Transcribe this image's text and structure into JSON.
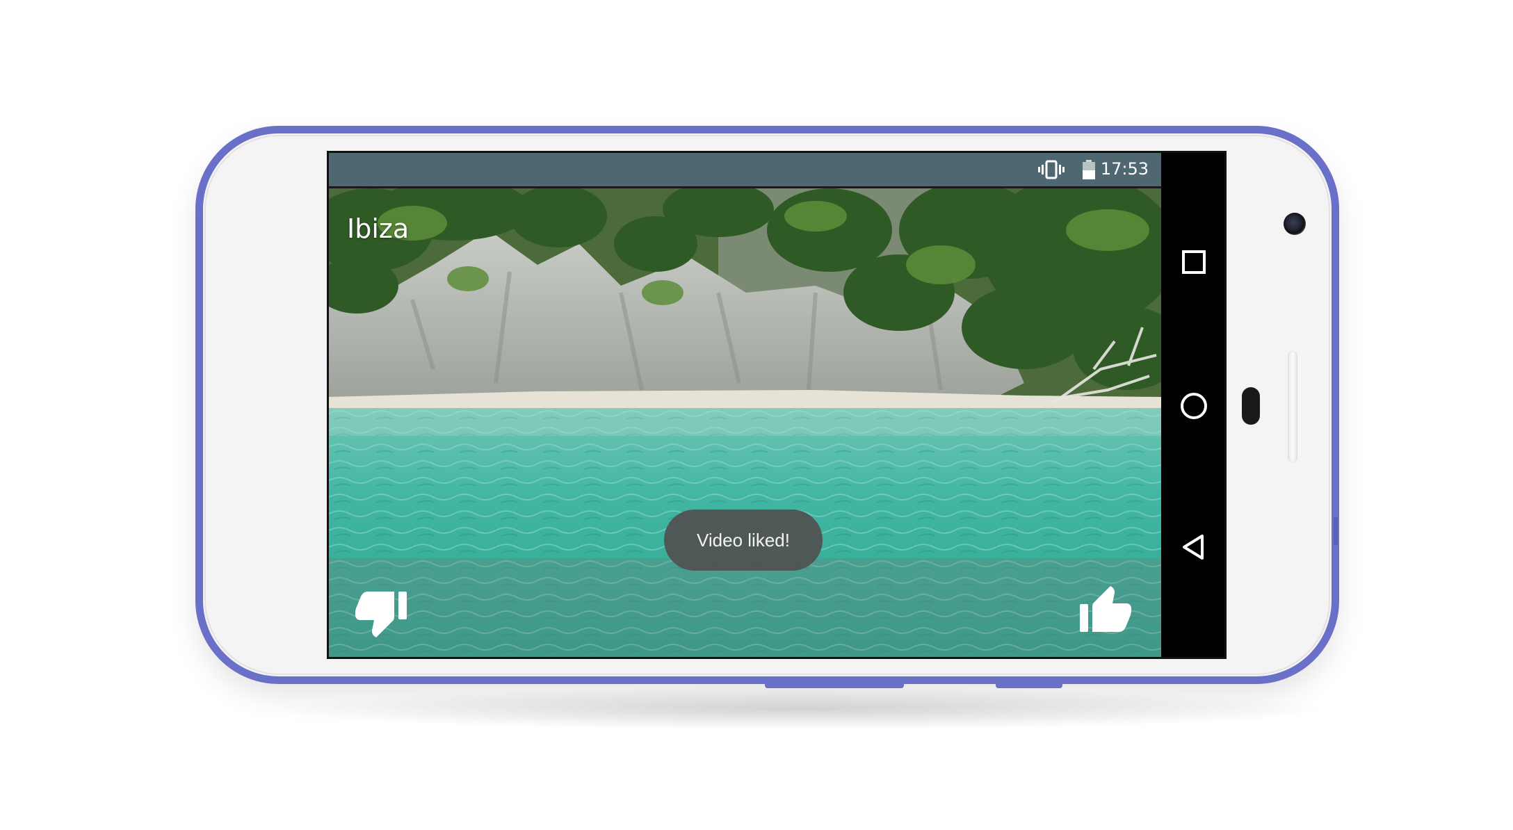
{
  "status_bar": {
    "time": "17:53",
    "icons": [
      "vibrate-icon",
      "battery-icon"
    ]
  },
  "video": {
    "title": "Ibiza"
  },
  "toast": {
    "message": "Video liked!"
  },
  "controls": {
    "dislike_icon": "thumbs-down-icon",
    "like_icon": "thumbs-up-icon"
  },
  "navigation": {
    "icons": [
      "recents-square-icon",
      "home-circle-icon",
      "back-triangle-icon"
    ]
  },
  "colors": {
    "phone_frame": "#6a6fc8",
    "status_bar": "#4f6770",
    "toast": "#505050",
    "water": "#3fb3a0"
  }
}
